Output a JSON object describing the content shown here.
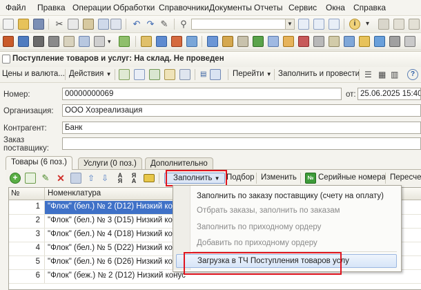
{
  "menu": [
    "Файл",
    "Правка",
    "Операции",
    "Обработки",
    "Справочники",
    "Документы",
    "Отчеты",
    "Сервис",
    "Окна",
    "Справка"
  ],
  "document_title": "Поступление товаров и услуг: На склад. Не проведен",
  "form_toolbar": {
    "prices_currency": "Цены и валюта...",
    "actions": "Действия",
    "goto": "Перейти",
    "fill_and_post": "Заполнить и провести"
  },
  "fields": {
    "number_label": "Номер:",
    "number_value": "00000000069",
    "date_label": "от:",
    "date_value": "25.06.2025 15:40:",
    "organization_label": "Организация:",
    "organization_value": "ООО Хозреализация",
    "contractor_label": "Контрагент:",
    "contractor_value": "Банк",
    "supplier_order_label_1": "Заказ",
    "supplier_order_label_2": "поставщику:"
  },
  "tabs": [
    "Товары (6 поз.)",
    "Услуги (0 поз.)",
    "Дополнительно"
  ],
  "table_toolbar": {
    "fill": "Заполнить",
    "selection": "Подбор",
    "change": "Изменить",
    "serial_numbers": "Серийные номера",
    "recalc": "Пересче"
  },
  "grid": {
    "col_num": "№",
    "col_name": "Номенклатура",
    "rows": [
      {
        "n": "1",
        "name": "\"Флок\" (бел.) № 2 (D12) Низкий кон"
      },
      {
        "n": "2",
        "name": "\"Флок\" (бел.) № 3 (D15) Низкий кон"
      },
      {
        "n": "3",
        "name": "\"Флок\" (бел.) № 4 (D18) Низкий кон"
      },
      {
        "n": "4",
        "name": "\"Флок\" (бел.) № 5 (D22) Низкий кон"
      },
      {
        "n": "5",
        "name": "\"Флок\" (бел.) № 6 (D26) Низкий кон"
      },
      {
        "n": "6",
        "name": "\"Флок\" (беж.) № 2 (D12) Низкий конус"
      }
    ]
  },
  "dropdown": {
    "item1": "Заполнить по заказу поставщику (счету на оплату)",
    "item2": "Отбрать заказы, заполнить по заказам",
    "item3": "Заполнить по приходному ордеру",
    "item4": "Добавить по приходному ордеру",
    "item5": "Загрузка в ТЧ Поступления товаров услу"
  },
  "colors": {
    "highlight_box": "#e0141e",
    "selection": "#3f71c7"
  }
}
